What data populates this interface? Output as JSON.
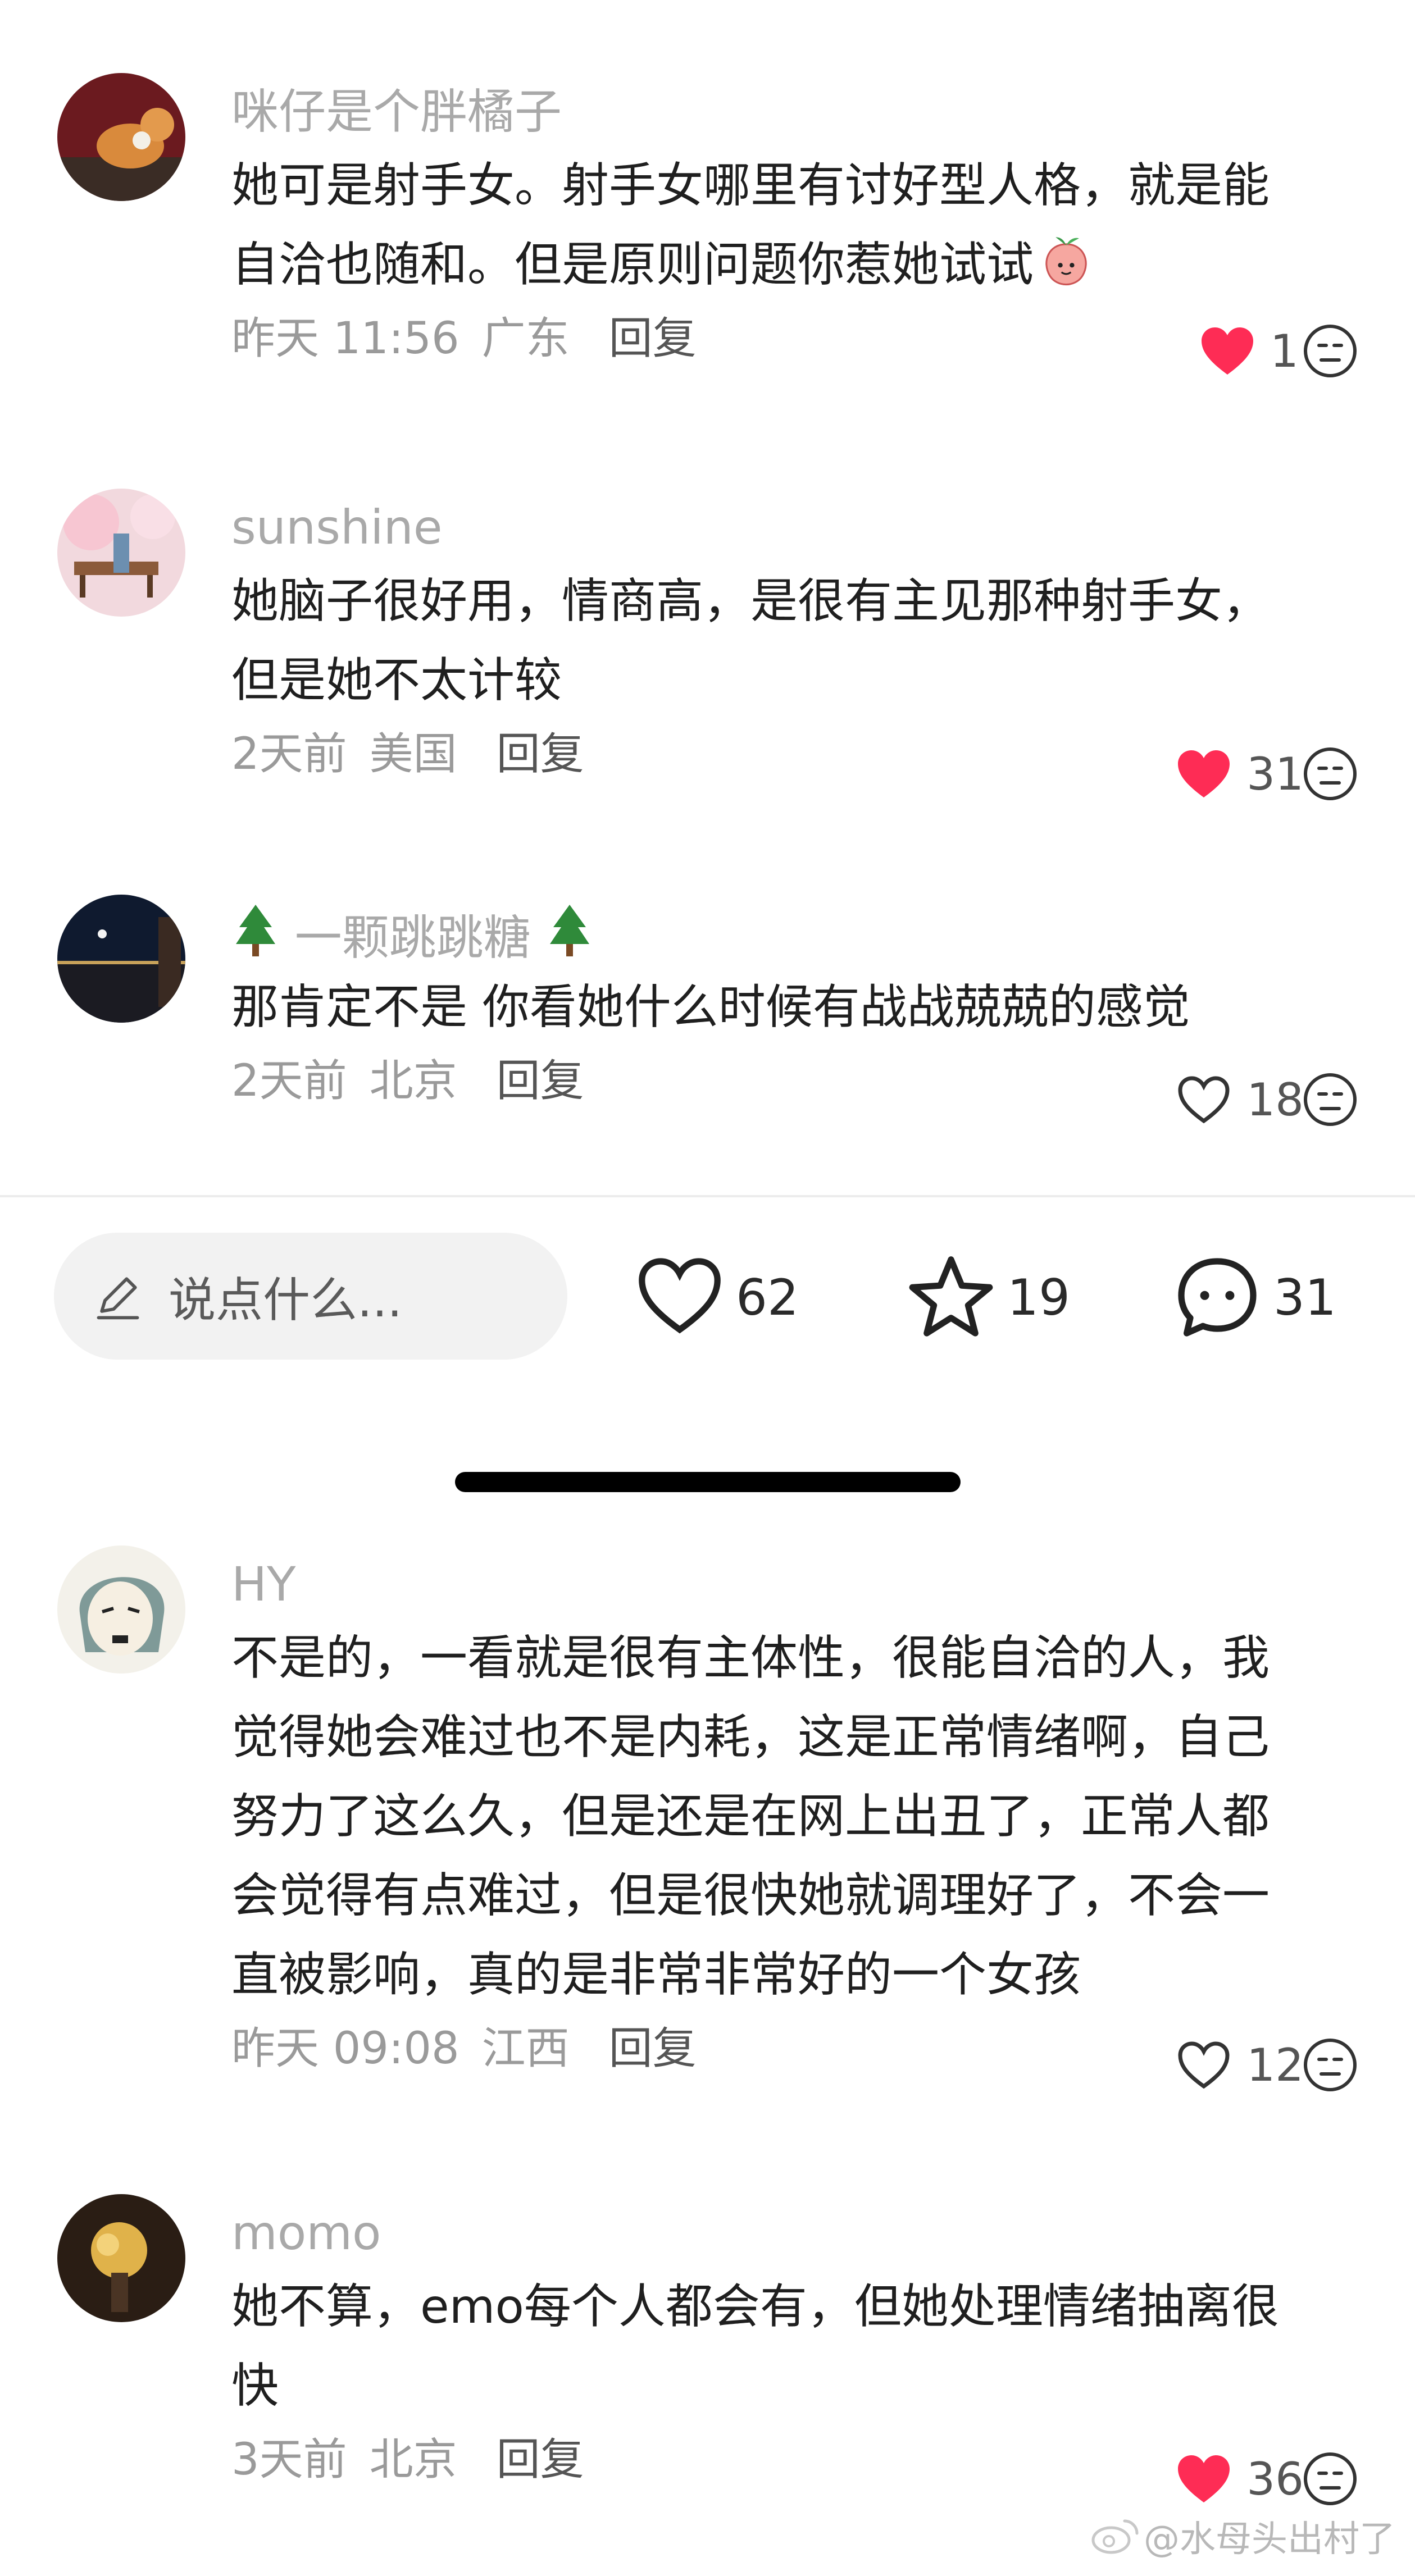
{
  "comments": [
    {
      "user": "咪仔是个胖橘子",
      "lines": [
        "她可是射手女。射手女哪里有讨好型人格，就是能",
        "自洽也随和。但是原则问题你惹她试试"
      ],
      "time": "昨天 11:56",
      "region": "广东",
      "reply": "回复",
      "likes": "1",
      "liked": true
    },
    {
      "user": "sunshine",
      "lines": [
        "她脑子很好用，情商高，是很有主见那种射手女，",
        "但是她不太计较"
      ],
      "time": "2天前",
      "region": "美国",
      "reply": "回复",
      "likes": "31",
      "liked": true
    },
    {
      "user": "一颗跳跳糖",
      "lines": [
        "那肯定不是 你看她什么时候有战战兢兢的感觉"
      ],
      "time": "2天前",
      "region": "北京",
      "reply": "回复",
      "likes": "18",
      "liked": false
    },
    {
      "user": "HY",
      "lines": [
        "不是的，一看就是很有主体性，很能自洽的人，我",
        "觉得她会难过也不是内耗，这是正常情绪啊，自己",
        "努力了这么久，但是还是在网上出丑了，正常人都",
        "会觉得有点难过，但是很快她就调理好了，不会一",
        "直被影响，真的是非常非常好的一个女孩"
      ],
      "time": "昨天 09:08",
      "region": "江西",
      "reply": "回复",
      "likes": "12",
      "liked": false
    },
    {
      "user": "momo",
      "lines": [
        "她不算，emo每个人都会有，但她处理情绪抽离很",
        "快"
      ],
      "time": "3天前",
      "region": "北京",
      "reply": "回复",
      "likes": "36",
      "liked": true
    }
  ],
  "bottom_bar": {
    "placeholder": "说点什么...",
    "likes": "62",
    "favorites": "19",
    "comments": "31"
  },
  "watermark": "@水母头出村了",
  "colors": {
    "like_red": "#fe2c55",
    "meta_gray": "#9a9a9a",
    "username_gray": "#a9a9a9"
  }
}
